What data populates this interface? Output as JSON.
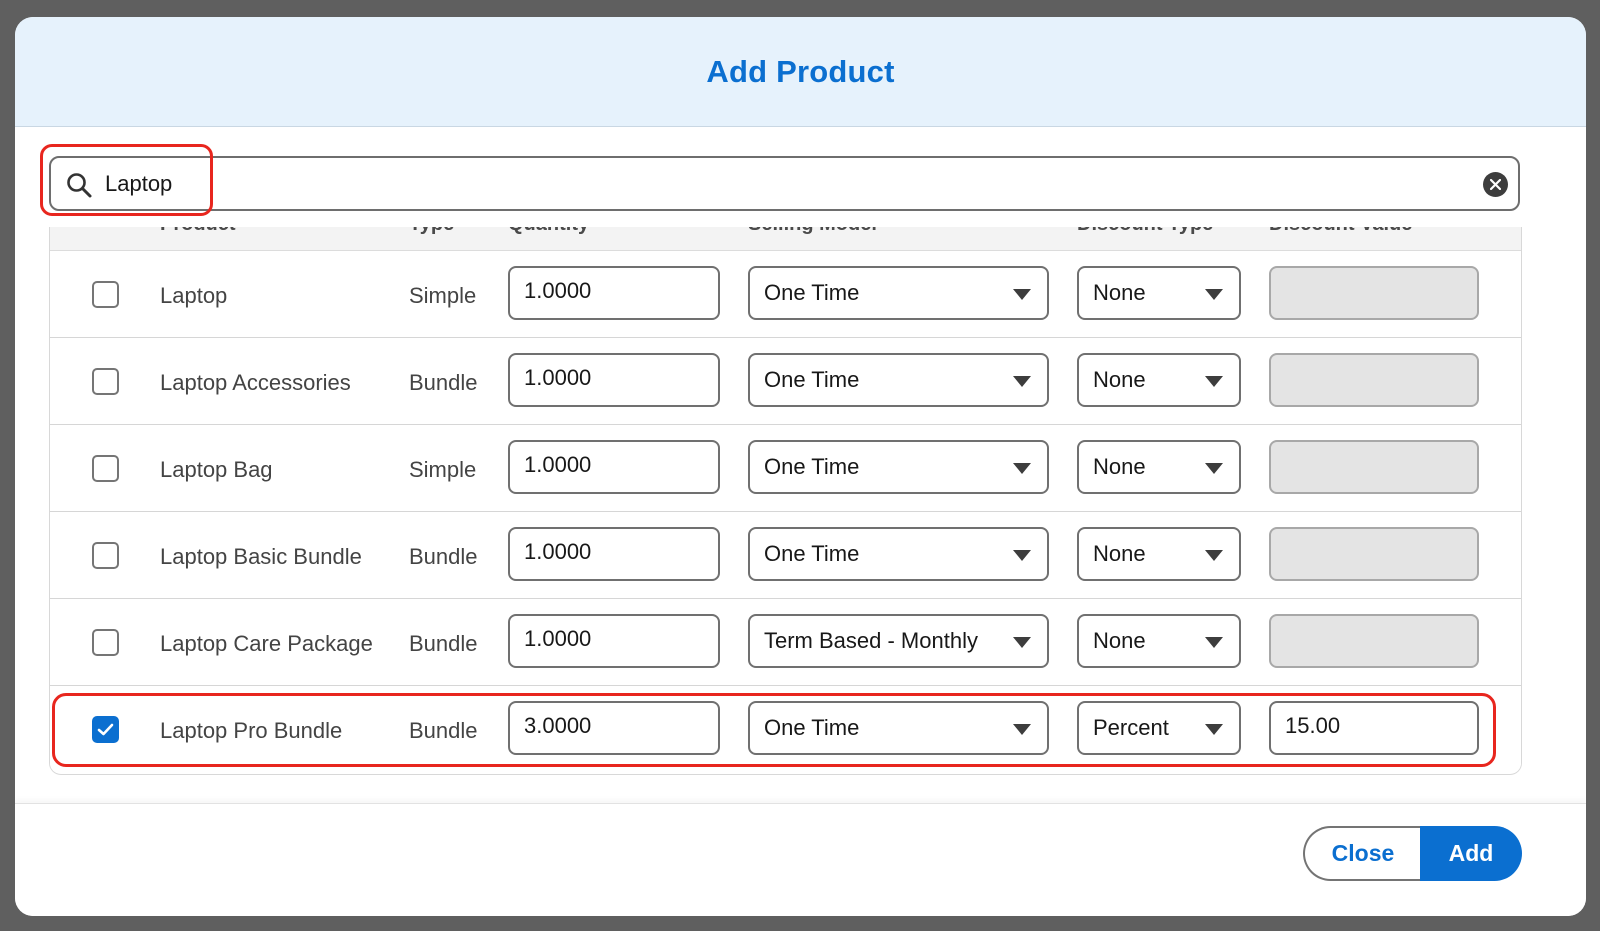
{
  "modal": {
    "title": "Add Product"
  },
  "search": {
    "value": "Laptop",
    "clear_icon": "close-circle-icon",
    "search_icon": "search-icon"
  },
  "table": {
    "headers": [
      "Product",
      "Type",
      "Quantity",
      "Selling Model",
      "Discount Type",
      "Discount Value"
    ],
    "rows": [
      {
        "checked": false,
        "name": "Laptop",
        "type": "Simple",
        "quantity": "1.0000",
        "selling_model": "One Time",
        "discount_type": "None",
        "discount_value": ""
      },
      {
        "checked": false,
        "name": "Laptop Accessories",
        "type": "Bundle",
        "quantity": "1.0000",
        "selling_model": "One Time",
        "discount_type": "None",
        "discount_value": ""
      },
      {
        "checked": false,
        "name": "Laptop Bag",
        "type": "Simple",
        "quantity": "1.0000",
        "selling_model": "One Time",
        "discount_type": "None",
        "discount_value": ""
      },
      {
        "checked": false,
        "name": "Laptop Basic Bundle",
        "type": "Bundle",
        "quantity": "1.0000",
        "selling_model": "One Time",
        "discount_type": "None",
        "discount_value": ""
      },
      {
        "checked": false,
        "name": "Laptop Care Package",
        "type": "Bundle",
        "quantity": "1.0000",
        "selling_model": "Term Based - Monthly",
        "discount_type": "None",
        "discount_value": ""
      },
      {
        "checked": true,
        "name": "Laptop Pro Bundle",
        "type": "Bundle",
        "quantity": "3.0000",
        "selling_model": "One Time",
        "discount_type": "Percent",
        "discount_value": "15.00"
      }
    ]
  },
  "footer": {
    "close_label": "Close",
    "add_label": "Add"
  },
  "colors": {
    "accent": "#0b6fd0",
    "highlight": "#e8261e",
    "header_bg": "#e6f2fc"
  }
}
